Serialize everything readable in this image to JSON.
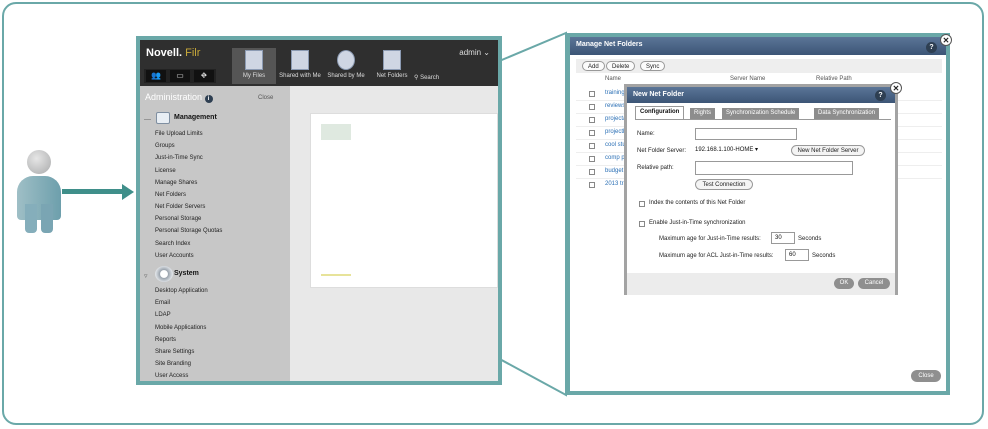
{
  "filr": {
    "brand": "Novell.",
    "brand_accent": " Filr",
    "user": "admin",
    "tool_tiles": [
      "👥",
      "▭",
      "⛖"
    ],
    "nav": [
      {
        "label": "My Files",
        "active": true
      },
      {
        "label": "Shared with Me",
        "active": false
      },
      {
        "label": "Shared by Me",
        "active": false
      },
      {
        "label": "Net Folders",
        "active": false
      }
    ],
    "search_label": "Search",
    "admin_title": "Administration",
    "admin_close": "Close",
    "management": {
      "title": "Management",
      "items": [
        "File Upload Limits",
        "Groups",
        "Just-in-Time Sync",
        "License",
        "Manage Shares",
        "Net Folders",
        "Net Folder Servers",
        "Personal Storage",
        "Personal Storage Quotas",
        "Search Index",
        "User Accounts"
      ]
    },
    "system": {
      "title": "System",
      "items": [
        "Desktop Application",
        "Email",
        "LDAP",
        "Mobile Applications",
        "Reports",
        "Share Settings",
        "Site Branding",
        "User Access"
      ]
    }
  },
  "manage_net_folders": {
    "title": "Manage Net Folders",
    "toolbar": {
      "add": "Add",
      "delete": "Delete",
      "sync": "Sync"
    },
    "columns": {
      "name": "Name",
      "server": "Server Name",
      "path": "Relative Path"
    },
    "rows": [
      "training",
      "reviews",
      "projecta",
      "projectb",
      "cool stu",
      "comp pl",
      "budget",
      "2013 tra"
    ],
    "close": "Close"
  },
  "new_net_folder": {
    "title": "New Net Folder",
    "tabs": [
      "Configuration",
      "Rights",
      "Synchronization Schedule",
      "Data Synchronization"
    ],
    "name_label": "Name:",
    "name_value": "",
    "server_label": "Net Folder Server:",
    "server_value": "192.168.1.100-HOME",
    "new_server_button": "New Net Folder Server",
    "path_label": "Relative path:",
    "path_value": "",
    "test_connection": "Test Connection",
    "index_label": "Index the contents of this Net Folder",
    "jit_label": "Enable Just-in-Time synchronization",
    "max_age_label": "Maximum age for Just-in-Time results:",
    "max_age_value": "30",
    "max_age_acl_label": "Maximum age for ACL Just-in-Time results:",
    "max_age_acl_value": "60",
    "seconds": "Seconds",
    "ok": "OK",
    "cancel": "Cancel"
  },
  "colors": {
    "frame": "#6aa8a8",
    "arrow": "#3f8f8a",
    "titlebar": "#4a6688",
    "link": "#2a6fb5"
  }
}
